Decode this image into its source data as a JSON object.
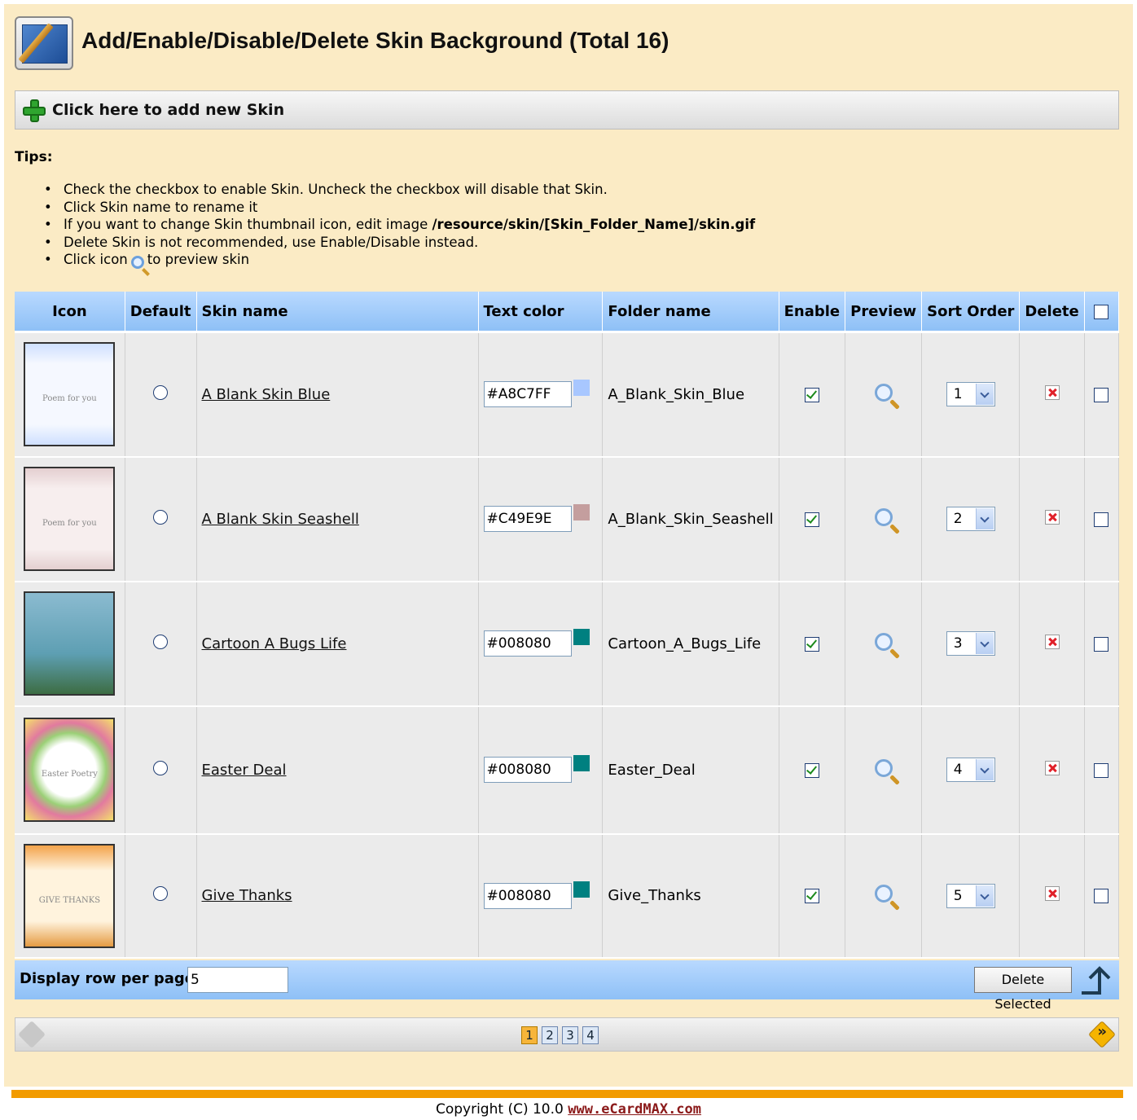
{
  "header": {
    "title": "Add/Enable/Disable/Delete Skin Background (Total 16)",
    "add_link": "Click here to add new Skin"
  },
  "tips": {
    "title": "Tips:",
    "items": [
      "Check the checkbox to enable Skin. Uncheck the checkbox will disable that Skin.",
      "Click Skin name to rename it",
      "If you want to change Skin thumbnail icon, edit image ",
      "Delete Skin is not recommended, use Enable/Disable instead.",
      "Click icon",
      "to preview skin"
    ],
    "path": "/resource/skin/[Skin_Folder_Name]/skin.gif"
  },
  "table": {
    "headers": {
      "icon": "Icon",
      "default": "Default",
      "skin_name": "Skin name",
      "text_color": "Text color",
      "folder_name": "Folder name",
      "enable": "Enable",
      "preview": "Preview",
      "sort_order": "Sort Order",
      "delete": "Delete"
    },
    "rows": [
      {
        "thumb_text": "Poem for you",
        "name": "A Blank Skin Blue",
        "color": "#A8C7FF",
        "swatch": "#A8C7FF",
        "folder": "A_Blank_Skin_Blue",
        "enabled": true,
        "order": "1"
      },
      {
        "thumb_text": "Poem for you",
        "name": "A Blank Skin Seashell",
        "color": "#C49E9E",
        "swatch": "#C49E9E",
        "folder": "A_Blank_Skin_Seashell",
        "enabled": true,
        "order": "2"
      },
      {
        "thumb_text": "",
        "name": "Cartoon A Bugs Life",
        "color": "#008080",
        "swatch": "#008080",
        "folder": "Cartoon_A_Bugs_Life",
        "enabled": true,
        "order": "3"
      },
      {
        "thumb_text": "Easter Poetry",
        "name": "Easter Deal",
        "color": "#008080",
        "swatch": "#008080",
        "folder": "Easter_Deal",
        "enabled": true,
        "order": "4"
      },
      {
        "thumb_text": "GIVE THANKS",
        "name": "Give Thanks",
        "color": "#008080",
        "swatch": "#008080",
        "folder": "Give_Thanks",
        "enabled": true,
        "order": "5"
      }
    ]
  },
  "footer_row": {
    "rows_label": "Display row per page",
    "rows_value": "5",
    "delete_selected": "Delete Selected"
  },
  "pager": {
    "pages": [
      "1",
      "2",
      "3",
      "4"
    ],
    "current": "1"
  },
  "copyright": {
    "text": "Copyright (C) 10.0",
    "link": "www.eCardMAX.com"
  }
}
